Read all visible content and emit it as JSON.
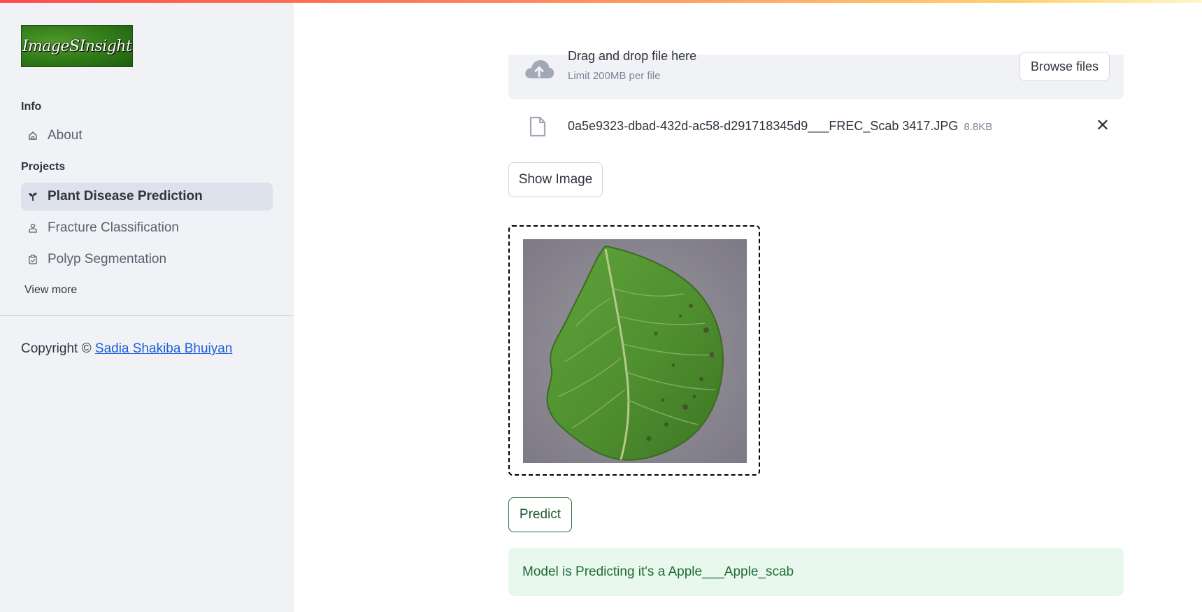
{
  "sidebar": {
    "logo_text": "ImageSInsight",
    "info_label": "Info",
    "about_label": "About",
    "projects_label": "Projects",
    "projects": [
      {
        "label": "Plant Disease Prediction",
        "icon": "seedling-icon",
        "active": true
      },
      {
        "label": "Fracture Classification",
        "icon": "person-icon",
        "active": false
      },
      {
        "label": "Polyp Segmentation",
        "icon": "clipboard-icon",
        "active": false
      }
    ],
    "view_more": "View more",
    "copyright_prefix": "Copyright ©",
    "copyright_author": "Sadia Shakiba Bhuiyan"
  },
  "uploader": {
    "title": "Drag and drop file here",
    "limit": "Limit 200MB per file",
    "browse_label": "Browse files",
    "file_name": "0a5e9323-dbad-432d-ac58-d291718345d9___FREC_Scab 3417.JPG",
    "file_size": "8.8KB"
  },
  "main": {
    "show_image_label": "Show Image",
    "predict_label": "Predict",
    "result_text": "Model is Predicting it's a Apple___Apple_scab"
  },
  "colors": {
    "sidebar_bg": "#f0f2f6",
    "active_item_bg": "#dde1ec",
    "success_bg": "#e8f8ec",
    "success_text": "#1e6b39",
    "link": "#1c5fd6"
  }
}
